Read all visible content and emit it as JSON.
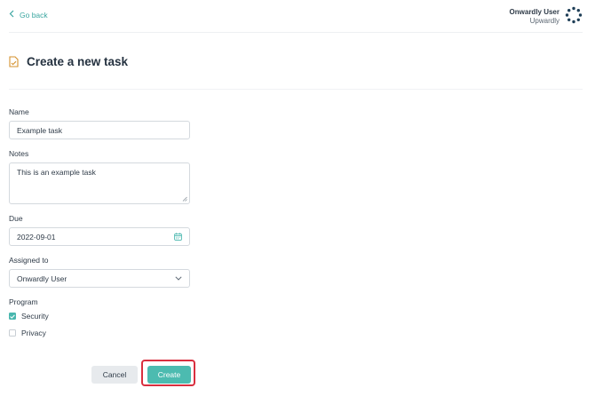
{
  "nav": {
    "go_back_label": "Go back"
  },
  "user": {
    "name": "Onwardly User",
    "org": "Upwardly"
  },
  "page": {
    "title": "Create a new task"
  },
  "form": {
    "name": {
      "label": "Name",
      "value": "Example task"
    },
    "notes": {
      "label": "Notes",
      "value": "This is an example task"
    },
    "due": {
      "label": "Due",
      "value": "2022-09-01"
    },
    "assigned_to": {
      "label": "Assigned to",
      "value": "Onwardly User"
    },
    "program": {
      "label": "Program",
      "options": [
        {
          "label": "Security",
          "checked": true
        },
        {
          "label": "Privacy",
          "checked": false
        }
      ]
    }
  },
  "actions": {
    "cancel_label": "Cancel",
    "create_label": "Create"
  },
  "colors": {
    "accent": "#4cbbb0",
    "link": "#3aa6a0",
    "highlight": "#d92f3f",
    "icon_orange": "#d4922e"
  },
  "icons": {
    "back": "chevron-left-icon",
    "avatar": "onwardly-logo-icon",
    "task": "task-document-icon",
    "calendar": "calendar-icon",
    "select": "chevron-down-icon",
    "check": "check-icon"
  }
}
